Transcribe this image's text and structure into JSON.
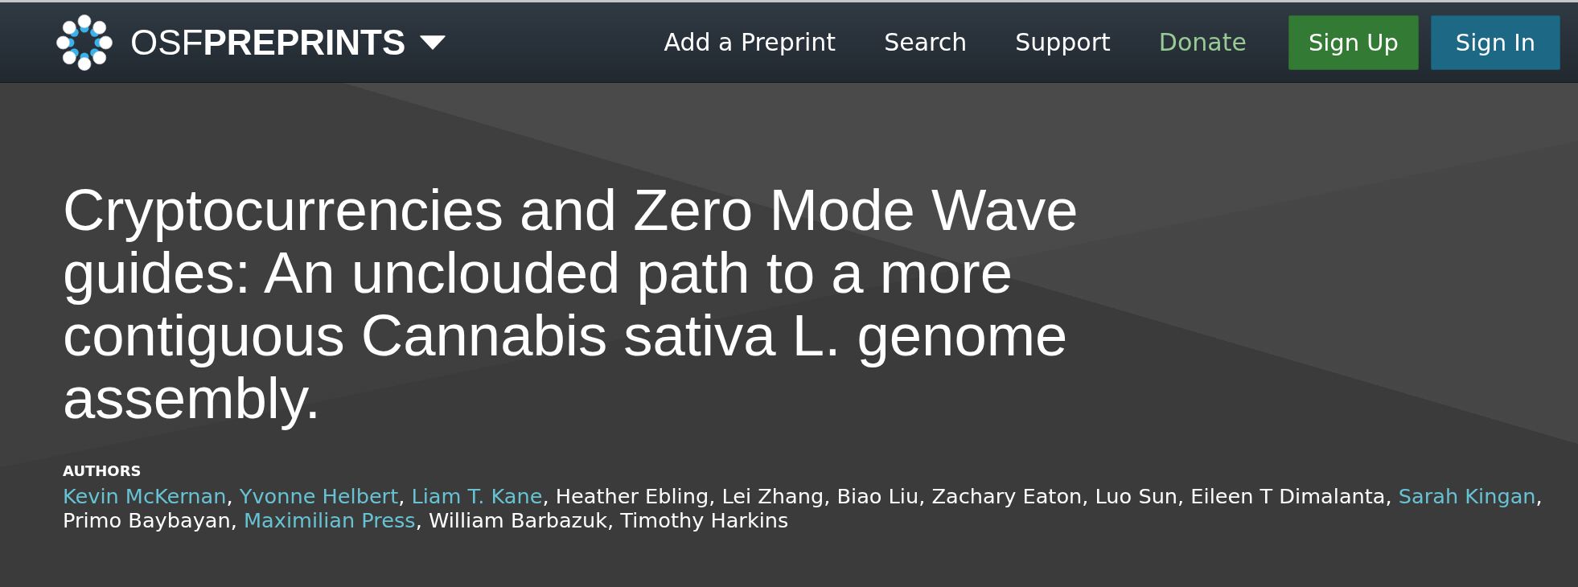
{
  "header": {
    "brand": "OSF**PREPRINTS**",
    "nav": [
      {
        "label": "Add a Preprint",
        "kind": "link"
      },
      {
        "label": "Search",
        "kind": "link"
      },
      {
        "label": "Support",
        "kind": "link"
      },
      {
        "label": "Donate",
        "kind": "donate"
      }
    ],
    "buttons": [
      {
        "label": "Sign Up",
        "kind": "signup"
      },
      {
        "label": "Sign In",
        "kind": "signin"
      }
    ]
  },
  "preprint": {
    "title": "Cryptocurrencies and Zero Mode Wave guides: An unclouded path to a more contiguous Cannabis sativa L. genome assembly.",
    "authors_label": "AUTHORS",
    "separator": ", ",
    "authors": [
      {
        "name": "Kevin McKernan",
        "linked": true
      },
      {
        "name": "Yvonne Helbert",
        "linked": true
      },
      {
        "name": "Liam T. Kane",
        "linked": true
      },
      {
        "name": "Heather Ebling",
        "linked": false
      },
      {
        "name": "Lei Zhang",
        "linked": false
      },
      {
        "name": "Biao Liu",
        "linked": false
      },
      {
        "name": "Zachary Eaton",
        "linked": false
      },
      {
        "name": "Luo Sun",
        "linked": false
      },
      {
        "name": "Eileen T Dimalanta",
        "linked": false
      },
      {
        "name": "Sarah Kingan",
        "linked": true
      },
      {
        "name": "Primo Baybayan",
        "linked": false
      },
      {
        "name": "Maximilian Press",
        "linked": true
      },
      {
        "name": "William Barbazuk",
        "linked": false
      },
      {
        "name": "Timothy Harkins",
        "linked": false
      }
    ]
  }
}
